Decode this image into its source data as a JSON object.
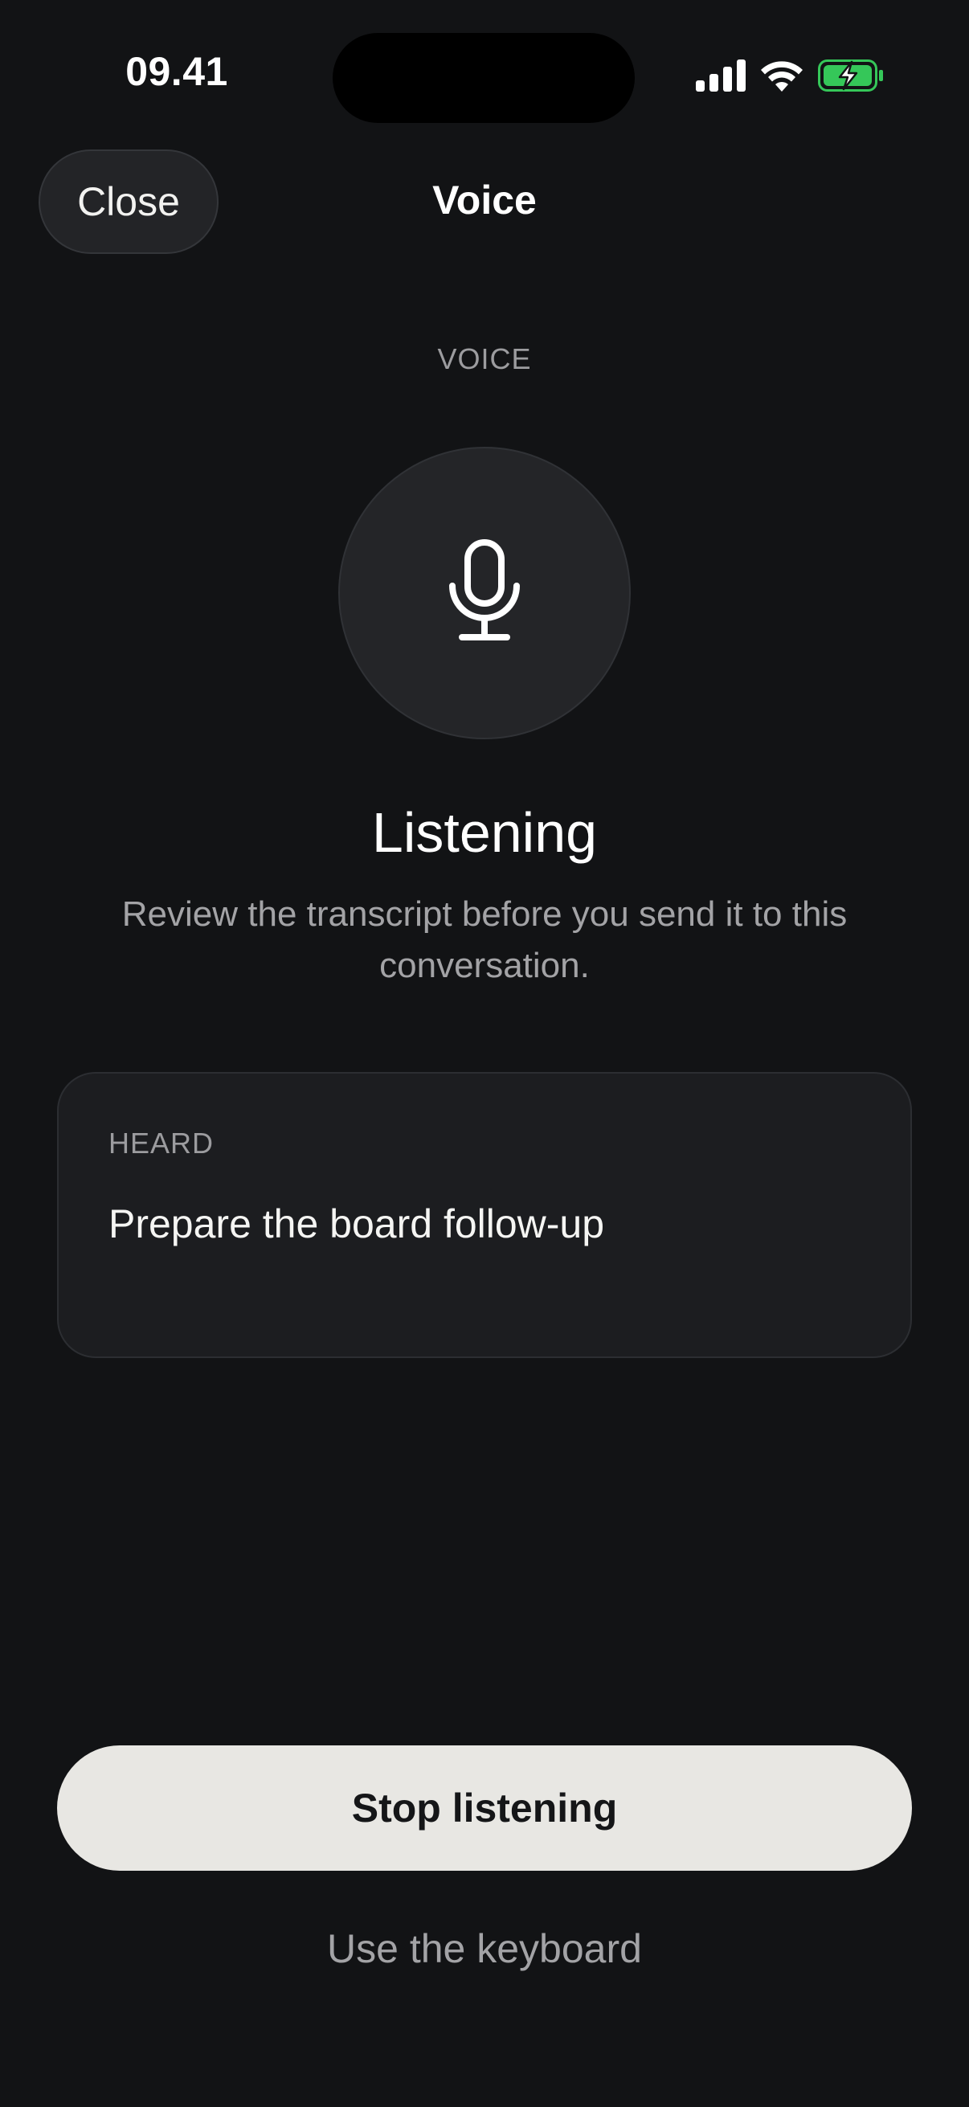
{
  "status_bar": {
    "time": "09.41",
    "icons": [
      "cellular-signal-icon",
      "wifi-icon",
      "battery-charging-icon"
    ],
    "battery_color": "#35c759"
  },
  "nav": {
    "close_label": "Close",
    "title": "Voice"
  },
  "hero": {
    "section_label": "VOICE",
    "icon": "microphone-icon",
    "status": "Listening",
    "description": "Review the transcript before you send it to this conversation."
  },
  "transcript": {
    "label": "HEARD",
    "text": "Prepare the board follow-up"
  },
  "actions": {
    "stop_label": "Stop listening",
    "keyboard_label": "Use the keyboard"
  },
  "colors": {
    "background": "#121315",
    "surface": "#1c1d20",
    "primary_button": "#e8e7e3",
    "muted_text": "#a3a3a6"
  }
}
